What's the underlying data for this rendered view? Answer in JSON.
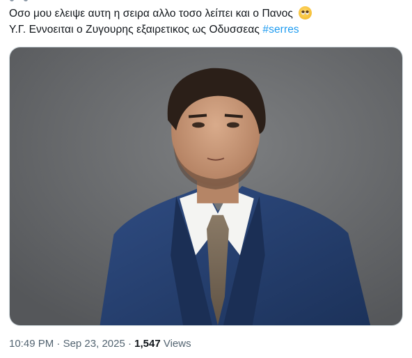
{
  "tweet": {
    "line1": "Οσο μου ελειψε αυτη η σειρα αλλο τοσο λείπει και ο Πανος",
    "line2_prefix": "Υ.Γ. Εννοειται ο Ζυγουρης εξαιρετικος ως Οδυσσεας ",
    "hashtag": "#serres",
    "emoji": "pleading-face-emoji"
  },
  "meta": {
    "time": "10:49 PM",
    "separator1": " · ",
    "date": "Sep 23, 2025",
    "separator2": " · ",
    "views_count": "1,547",
    "views_label": " Views"
  },
  "colors": {
    "hashtag": "#1d9bf0",
    "meta_text": "#536471",
    "primary_text": "#0f1419",
    "media_border": "#cfd9de",
    "suit": "#253f6e",
    "background_photo": "#6b6d6f"
  }
}
